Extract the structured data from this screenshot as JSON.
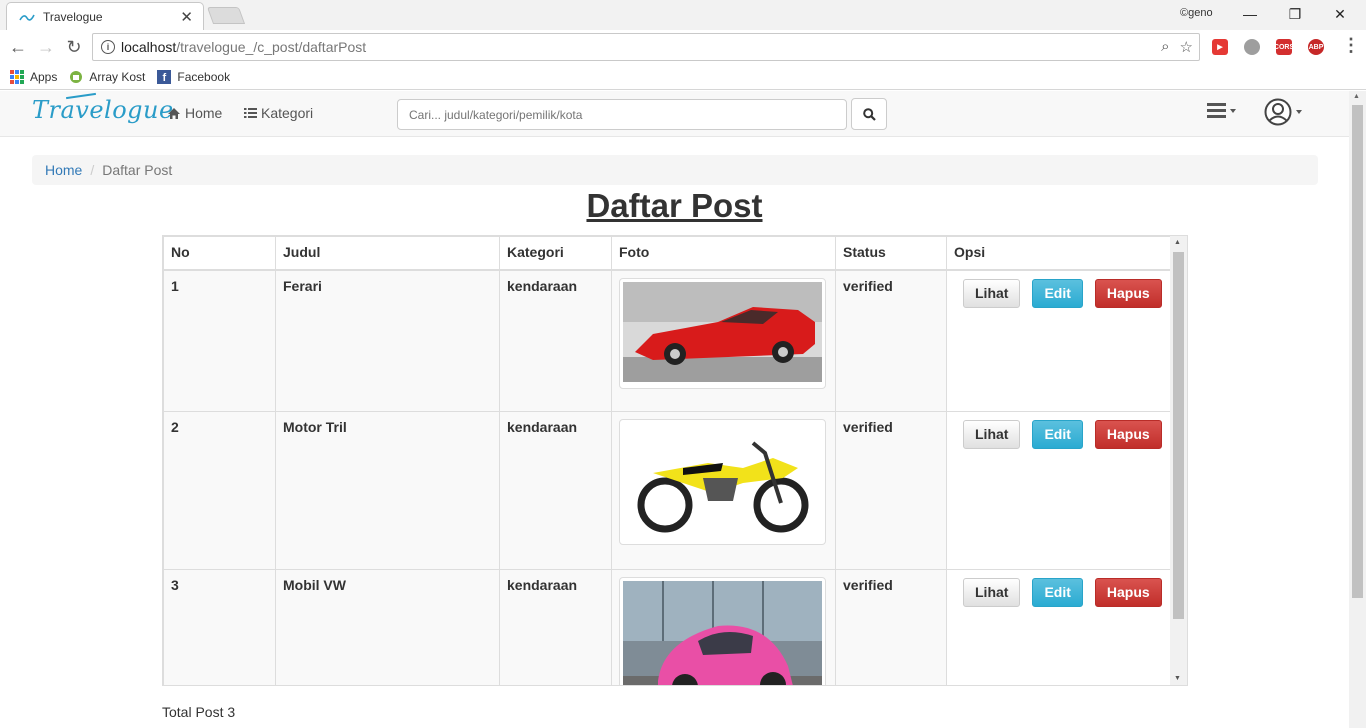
{
  "browser": {
    "tab_title": "Travelogue",
    "user_label": "©geno",
    "url_host": "localhost",
    "url_path": "/travelogue_/c_post/daftarPost",
    "bookmarks": [
      "Apps",
      "Array Kost",
      "Facebook"
    ],
    "extensions": [
      "CORS",
      "ABP"
    ]
  },
  "navbar": {
    "brand": "Travelogue",
    "home_label": "Home",
    "kategori_label": "Kategori",
    "search_placeholder": "Cari... judul/kategori/pemilik/kota"
  },
  "breadcrumb": {
    "home": "Home",
    "sep": "/",
    "current": "Daftar Post"
  },
  "page_title": "Daftar Post",
  "table": {
    "headers": [
      "No",
      "Judul",
      "Kategori",
      "Foto",
      "Status",
      "Opsi"
    ],
    "rows": [
      {
        "no": "1",
        "judul": "Ferari",
        "kategori": "kendaraan",
        "status": "verified"
      },
      {
        "no": "2",
        "judul": "Motor Tril",
        "kategori": "kendaraan",
        "status": "verified"
      },
      {
        "no": "3",
        "judul": "Mobil VW",
        "kategori": "kendaraan",
        "status": "verified"
      }
    ],
    "actions": {
      "view": "Lihat",
      "edit": "Edit",
      "delete": "Hapus"
    }
  },
  "total_label": "Total Post 3",
  "colors": {
    "link": "#337ab7",
    "info": "#2aabd2",
    "danger": "#c9302c",
    "brand": "#2a9cc8"
  },
  "icons": [
    "home-icon",
    "list-icon",
    "search-icon",
    "user-avatar-icon",
    "list-menu-icon"
  ]
}
